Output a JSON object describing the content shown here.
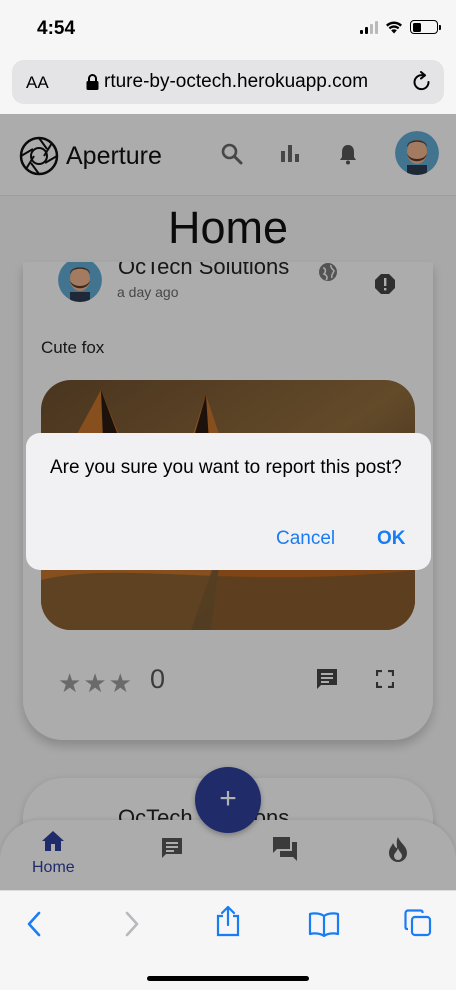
{
  "status_bar": {
    "time": "4:54"
  },
  "browser": {
    "text_size_label": "AA",
    "url": "rture-by-octech.herokuapp.com"
  },
  "app": {
    "brand": "Aperture",
    "page_title": "Home",
    "header_icons": [
      "search-icon",
      "bar-chart-icon",
      "bell-icon"
    ]
  },
  "post": {
    "author": "OcTech Solutions",
    "time_ago": "a day ago",
    "text": "Cute fox",
    "rating_value": "0",
    "star_count": 3
  },
  "next_post": {
    "author": "OcTech Solutions"
  },
  "fab_label": "+",
  "bottom_nav": {
    "items": [
      {
        "label": "Home",
        "icon": "home-icon"
      },
      {
        "icon": "feed-icon"
      },
      {
        "icon": "chat-icon"
      },
      {
        "icon": "fire-icon"
      }
    ]
  },
  "dialog": {
    "message": "Are you sure you want to report this post?",
    "cancel": "Cancel",
    "ok": "OK"
  },
  "colors": {
    "accent": "#2f3e99",
    "ios_blue": "#1a7cf5"
  }
}
